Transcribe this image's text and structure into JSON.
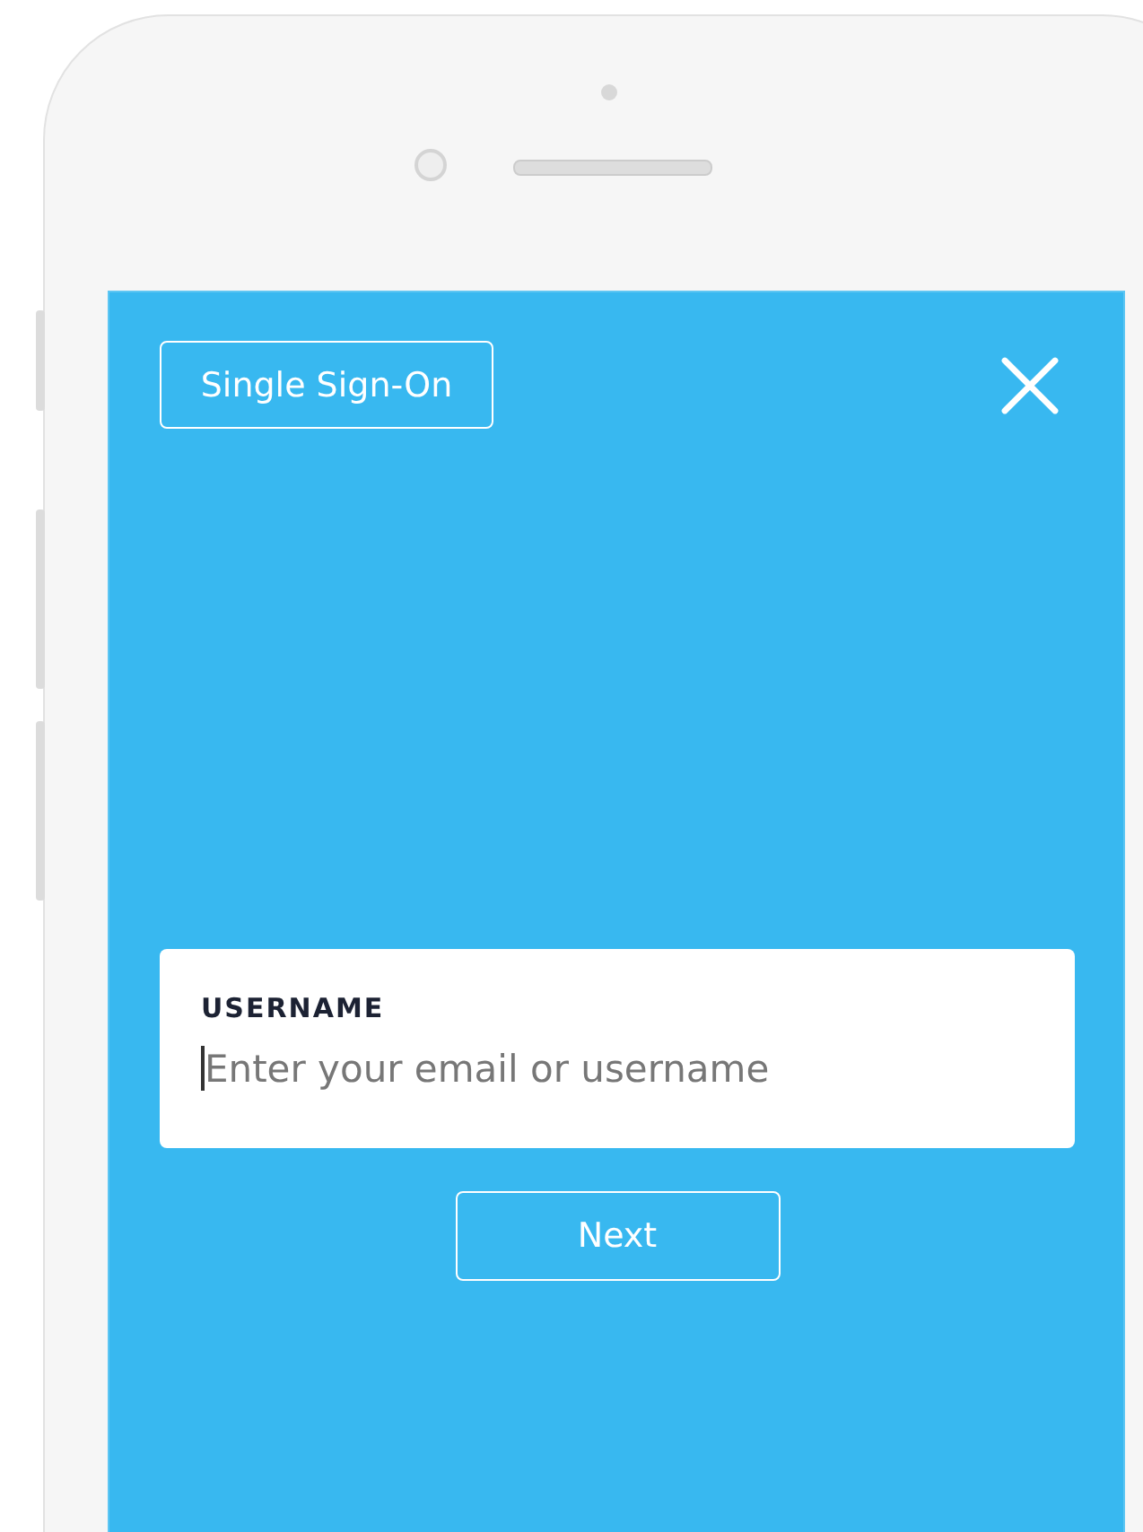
{
  "sso_button": {
    "label": "Single Sign-On"
  },
  "username": {
    "label": "USERNAME",
    "placeholder": "Enter your email or username"
  },
  "next_button": {
    "label": "Next"
  }
}
